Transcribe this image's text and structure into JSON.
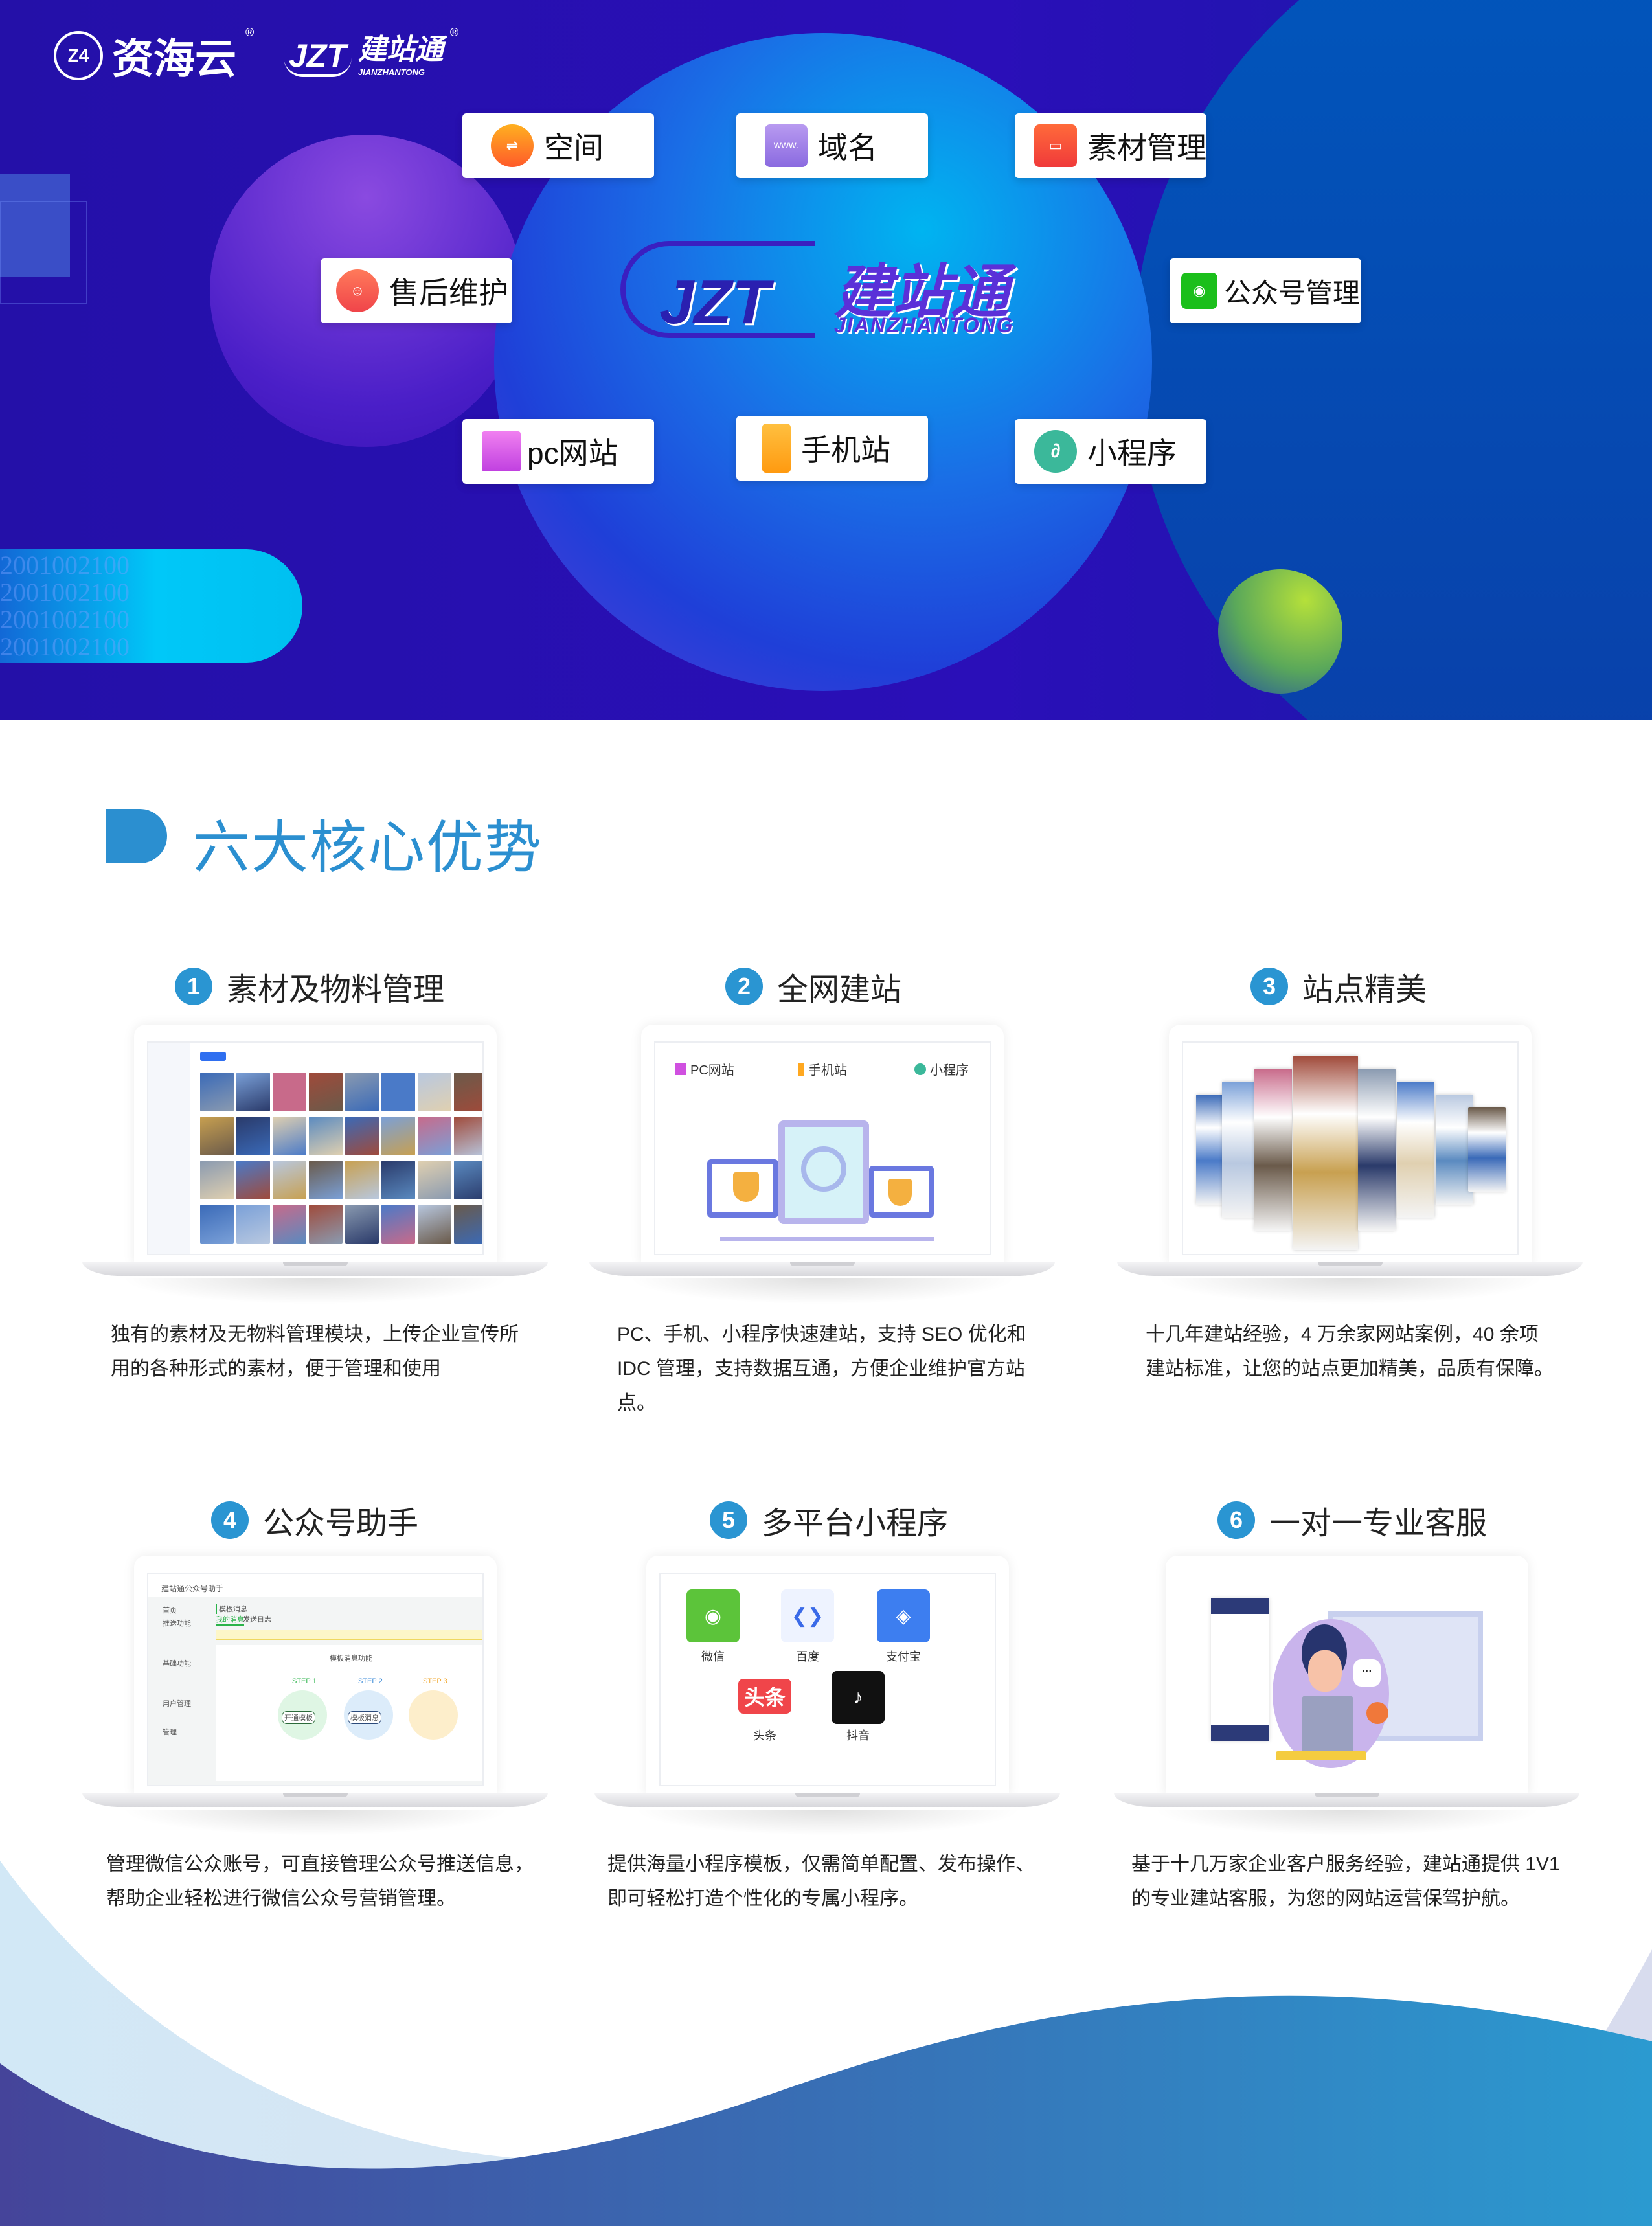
{
  "brand": {
    "zihaiyun": "资海云",
    "zihaiyun_mark": "Z4",
    "jzt_mark": "JZT",
    "jzt_cn": "建站通",
    "jzt_en": "JIANZHANTONG",
    "registered": "®"
  },
  "hero": {
    "center_logo": {
      "mark": "JZT",
      "cn": "建站通",
      "en": "JIANZHANTONG"
    },
    "binary_text": "2001002100",
    "features": [
      {
        "label": "空间",
        "icon": "space-icon"
      },
      {
        "label": "域名",
        "icon": "domain-www-icon",
        "icon_text": "www."
      },
      {
        "label": "素材管理",
        "icon": "wallet-icon"
      },
      {
        "label": "售后维护",
        "icon": "support-icon"
      },
      {
        "label": "公众号管理",
        "icon": "wechat-icon"
      },
      {
        "label": "pc网站",
        "icon": "monitor-icon"
      },
      {
        "label": "手机站",
        "icon": "phone-icon"
      },
      {
        "label": "小程序",
        "icon": "mini-program-icon"
      }
    ]
  },
  "section": {
    "title": "六大核心优势",
    "accent": "#2b8fd0"
  },
  "cards": [
    {
      "num": "1",
      "title": "素材及物料管理",
      "desc": [
        "独有的素材及无物料管理模块，上传企业宣传所",
        "用的各种形式的素材，便于管理和使用"
      ]
    },
    {
      "num": "2",
      "title": "全网建站",
      "desc": [
        "PC、手机、小程序快速建站，支持 SEO 优化和",
        "IDC 管理，支持数据互通，方便企业维护官方站点。"
      ],
      "chips": [
        "PC网站",
        "手机站",
        "小程序"
      ]
    },
    {
      "num": "3",
      "title": "站点精美",
      "desc": [
        "十几年建站经验，4 万余家网站案例，40 余项",
        "建站标准，让您的站点更加精美，品质有保障。"
      ]
    },
    {
      "num": "4",
      "title": "公众号助手",
      "desc": [
        "管理微信公众账号，可直接管理公众号推送信息，",
        "帮助企业轻松进行微信公众号营销管理。"
      ],
      "screen": {
        "app_title": "建站通公众号助手",
        "menu": [
          "首页",
          "推送功能",
          "基础功能",
          "用户管理",
          "管理"
        ],
        "heading": "模板消息",
        "tabs": [
          "我的消息",
          "发送日志"
        ],
        "feature_title": "模板消息功能",
        "steps": [
          "STEP 1",
          "STEP 2",
          "STEP 3"
        ],
        "step_labels": [
          "开通模板",
          "模板消息"
        ]
      }
    },
    {
      "num": "5",
      "title": "多平台小程序",
      "desc": [
        "提供海量小程序模板，仅需简单配置、发布操作、",
        "即可轻松打造个性化的专属小程序。"
      ],
      "platforms": [
        {
          "name": "微信",
          "color": "#5cc43a"
        },
        {
          "name": "百度",
          "color": "#eef3ff"
        },
        {
          "name": "支付宝",
          "color": "#3d7ef0"
        },
        {
          "name": "头条",
          "color": "#f0454a",
          "mark": "头条"
        },
        {
          "name": "抖音",
          "color": "#111111"
        }
      ]
    },
    {
      "num": "6",
      "title": "一对一专业客服",
      "desc": [
        "基于十几万家企业客户服务经验，建站通提供 1V1",
        "的专业建站客服，为您的网站运营保驾护航。"
      ]
    }
  ],
  "colors": {
    "hero_bg": "#2410a8",
    "number_badge": "#2a95d2",
    "wave_start": "#45449a",
    "wave_end": "#2b9ad0"
  }
}
